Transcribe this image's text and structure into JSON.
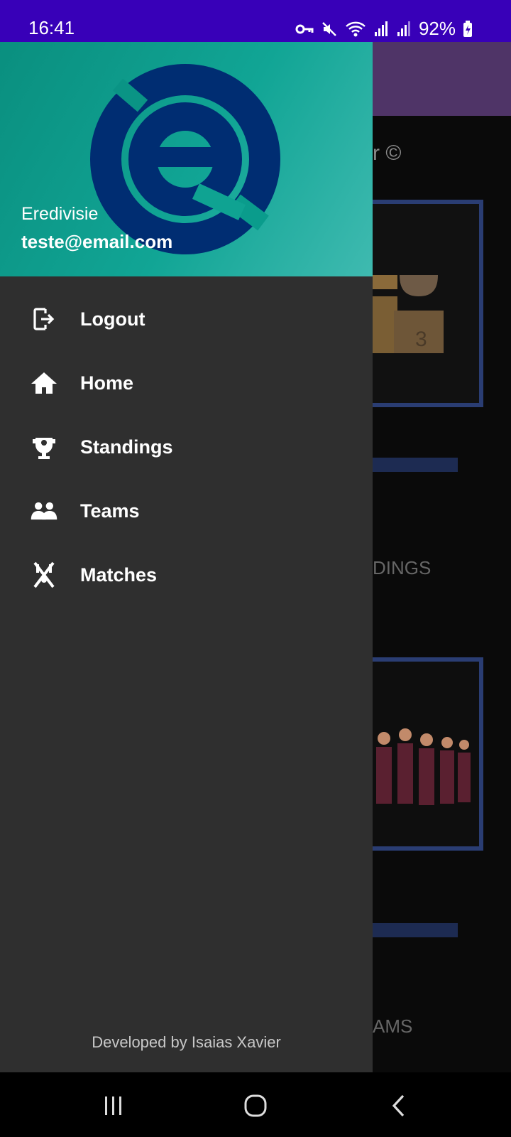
{
  "status_bar": {
    "time": "16:41",
    "battery": "92%",
    "icons": [
      "key-icon",
      "mute-icon",
      "wifi-icon",
      "signal-icon",
      "signal-icon-2",
      "battery-icon"
    ]
  },
  "background": {
    "title_fragment": "r ©",
    "label_standings_fragment": "DINGS",
    "label_teams_fragment": "AMS"
  },
  "drawer": {
    "header": {
      "name": "Eredivisie",
      "email": "teste@email.com",
      "logo": "eredivisie-logo"
    },
    "items": [
      {
        "label": "Logout",
        "icon": "logout-icon"
      },
      {
        "label": "Home",
        "icon": "home-icon"
      },
      {
        "label": "Standings",
        "icon": "standings-icon"
      },
      {
        "label": "Teams",
        "icon": "teams-icon"
      },
      {
        "label": "Matches",
        "icon": "matches-icon"
      }
    ],
    "footer": "Developed by Isaias Xavier"
  },
  "colors": {
    "status_bar": "#3800b8",
    "drawer_bg": "#2f2f2f",
    "header_gradient_start": "#0a8f7f",
    "header_gradient_end": "#3fbab0",
    "logo": "#002d72"
  }
}
